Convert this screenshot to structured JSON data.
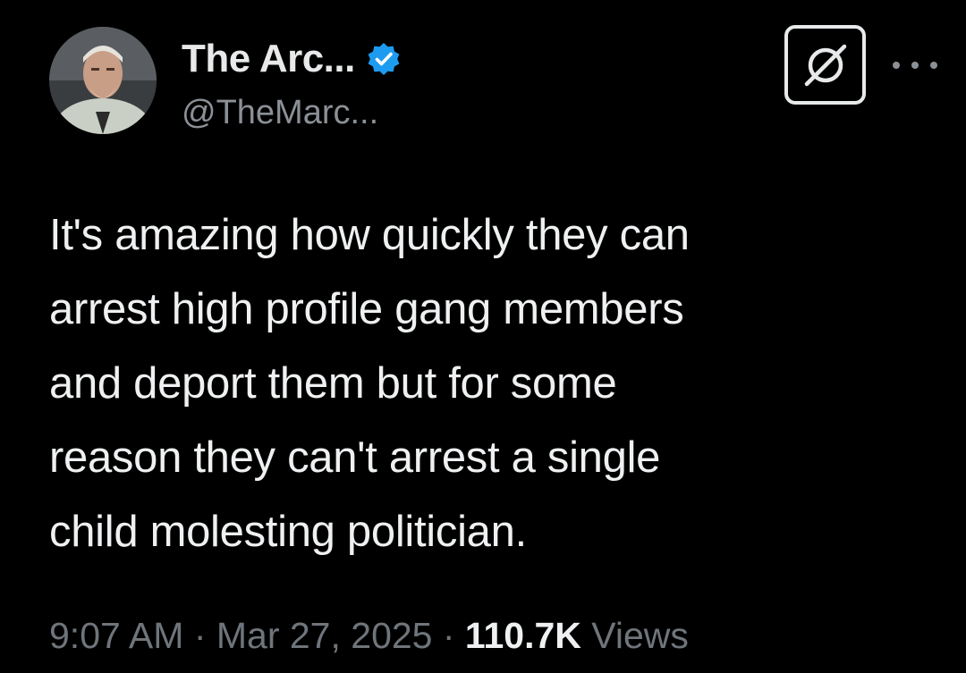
{
  "author": {
    "display_name": "The Arc...",
    "handle": "@TheMarc...",
    "verified_badge_color": "#1d9bf0",
    "avatar_icon": "profile-photo"
  },
  "header_actions": {
    "grok_icon": "grok-icon",
    "more_icon": "more-options-icon"
  },
  "tweet": {
    "text": "It's amazing how quickly they can\narrest high profile gang members\nand deport them but for some\nreason they can't arrest a single\nchild molesting politician."
  },
  "meta": {
    "time": "9:07 AM",
    "separator_1": " · ",
    "date": "Mar 27, 2025",
    "separator_2": " · ",
    "views_count": "110.7K",
    "views_label": " Views"
  },
  "colors": {
    "background": "#000000",
    "primary_text": "#e7e9ea",
    "secondary_text": "#8b9096",
    "accent": "#1d9bf0"
  }
}
